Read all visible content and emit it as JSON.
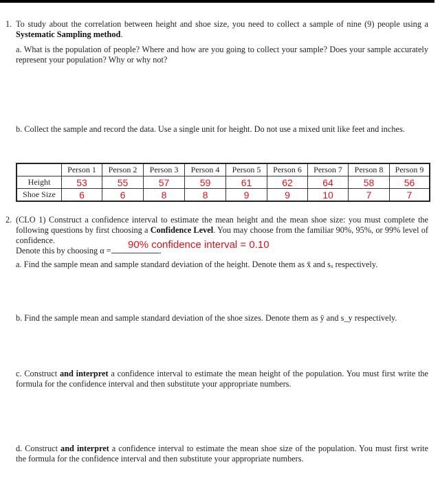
{
  "q1": {
    "number": "1.",
    "intro_pre": "To study about the correlation between height and shoe size, you need to collect a sample of nine (9) people using a ",
    "intro_bold": "Systematic Sampling method",
    "intro_post": ".",
    "a": "a. What is the population of people? Where and how are you going to collect your sample? Does your sample accurately represent your population? Why or why not?",
    "b": "b. Collect the sample and record the data. Use a single unit for height. Do not use a mixed unit like feet and inches.",
    "table": {
      "headers": [
        "",
        "Person 1",
        "Person 2",
        "Person 3",
        "Person 4",
        "Person 5",
        "Person 6",
        "Person 7",
        "Person 8",
        "Person 9"
      ],
      "rows": [
        {
          "label": "Height",
          "values": [
            "53",
            "55",
            "57",
            "59",
            "61",
            "62",
            "64",
            "58",
            "56"
          ]
        },
        {
          "label": "Shoe Size",
          "values": [
            "6",
            "6",
            "8",
            "8",
            "9",
            "9",
            "10",
            "7",
            "7"
          ]
        }
      ]
    }
  },
  "q2": {
    "number": "2.",
    "intro_pre": "(CLO 1) Construct a confidence interval to estimate the mean height and the mean shoe size: you must complete the following questions by first choosing a ",
    "intro_bold": "Confidence Level",
    "intro_post": ". You may choose from the familiar 90%, 95%, or 99% level of confidence.",
    "denote": "Denote this by choosing α =",
    "denote_end": ".",
    "answer": "90% confidence interval = 0.10",
    "a": "a. Find the sample mean and sample standard deviation of the height. Denote them as x̄ and sₓ respectively.",
    "b": "b. Find the sample mean and sample standard deviation of the shoe sizes. Denote them as ȳ and s_y respectively.",
    "c_pre": "c. Construct ",
    "c_bold": "and interpret",
    "c_post": " a confidence interval to estimate the mean height of the population. You must first write the formula for the confidence interval and then substitute your appropriate numbers.",
    "d_pre": "d. Construct ",
    "d_bold": "and interpret",
    "d_post": " a confidence interval to estimate the mean shoe size of the population. You must first write the formula for the confidence interval and then substitute your appropriate numbers."
  }
}
